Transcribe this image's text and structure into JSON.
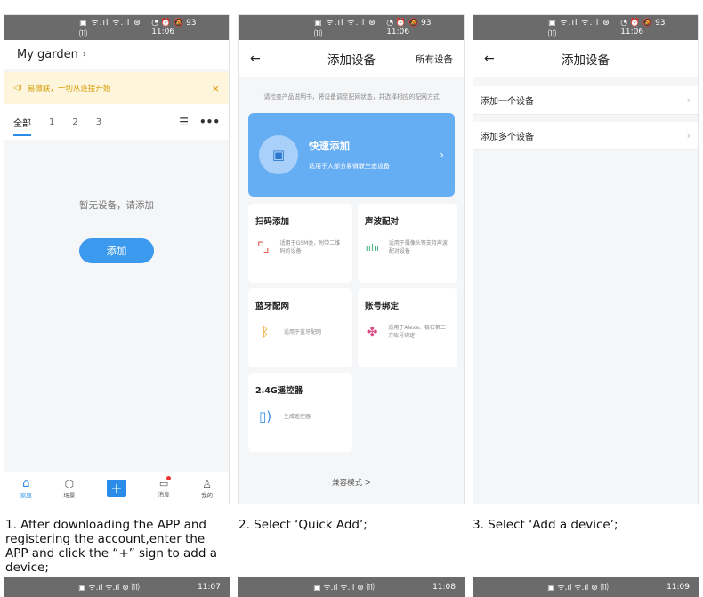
{
  "status": {
    "left_icons": "▣ ᯤ.ıl ᯤ.ıl ⊛ ⑾",
    "right_icons": "◔ ⏰ 🔕",
    "battery": "93",
    "time1": "11:06",
    "time2": "11:06",
    "time3": "11:06"
  },
  "strip_times": [
    "11:07",
    "11:08",
    "11:09"
  ],
  "screen1": {
    "title": "My garden",
    "notice": "易微联，一切从连接开始",
    "tabs": [
      "全部",
      "1",
      "2",
      "3"
    ],
    "empty_text": "暂无设备，请添加",
    "add_button": "添加",
    "tabbar": [
      {
        "label": "家庭",
        "icon": "home-icon"
      },
      {
        "label": "场景",
        "icon": "scene-icon"
      },
      {
        "label": "",
        "icon": "plus-icon"
      },
      {
        "label": "消息",
        "icon": "message-icon"
      },
      {
        "label": "我的",
        "icon": "user-icon"
      }
    ]
  },
  "screen2": {
    "title": "添加设备",
    "right_link": "所有设备",
    "hint": "请检查产品说明书，将设备调至配网状态，并选择相应的配网方式",
    "quick_title": "快速添加",
    "quick_sub": "适用于大部分易微联生态设备",
    "cards": [
      {
        "title": "扫码添加",
        "desc": "适用于GSM类，附带二维码的设备",
        "icon": "scan-icon",
        "glyph": "⌜⌟",
        "color": "#e25b4a"
      },
      {
        "title": "声波配对",
        "desc": "适用于摄像头等支持声波配对设备",
        "icon": "sound-wave-icon",
        "glyph": "ı|ıl|ı",
        "color": "#3fb07a"
      },
      {
        "title": "蓝牙配网",
        "desc": "适用于蓝牙配网",
        "icon": "bluetooth-icon",
        "glyph": "ᛒ",
        "color": "#f0a020"
      },
      {
        "title": "账号绑定",
        "desc": "适用于Alexa、极石第三方账号绑定",
        "icon": "account-bind-icon",
        "glyph": "✤",
        "color": "#d94c8a"
      },
      {
        "title": "2.4G遥控器",
        "desc": "生成遥控器",
        "icon": "remote-icon",
        "glyph": "▯",
        "color": "#3b8ee8"
      }
    ],
    "compat": "兼容模式 >"
  },
  "screen3": {
    "title": "添加设备",
    "rows": [
      "添加一个设备",
      "添加多个设备"
    ]
  },
  "captions": [
    "1. After downloading the APP and registering the account,enter the APP and click the “+” sign to add a device;",
    "2. Select ‘Quick Add’;",
    "3. Select ‘Add a device’;"
  ]
}
